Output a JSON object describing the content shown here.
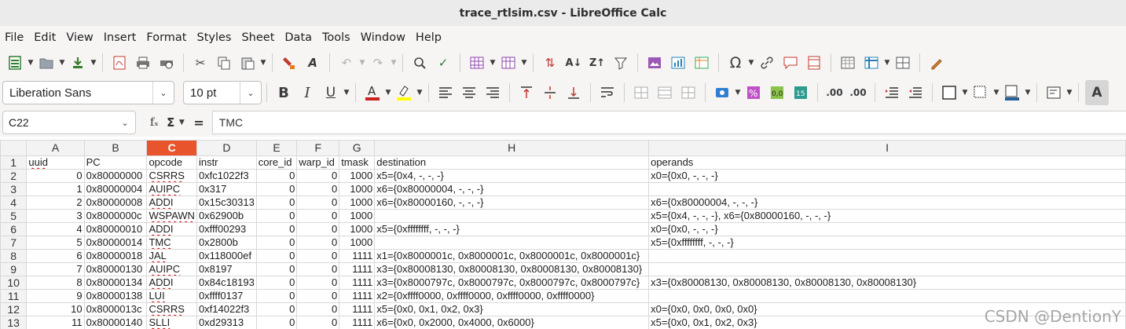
{
  "window": {
    "title": "trace_rtlsim.csv - LibreOffice Calc"
  },
  "menu": [
    "File",
    "Edit",
    "View",
    "Insert",
    "Format",
    "Styles",
    "Sheet",
    "Data",
    "Tools",
    "Window",
    "Help"
  ],
  "format_bar": {
    "font_name": "Liberation Sans",
    "font_size": "10 pt"
  },
  "formula_bar": {
    "cell_ref": "C22",
    "fx_label": "fₓ",
    "sigma_label": "Σ",
    "eq_label": "=",
    "content": "TMC"
  },
  "columns": [
    "A",
    "B",
    "C",
    "D",
    "E",
    "F",
    "G",
    "H",
    "I"
  ],
  "selected_column": "C",
  "rows": [
    {
      "n": "1",
      "cells": [
        "uuid",
        "PC",
        "opcode",
        "instr",
        "core_id",
        "warp_id",
        "tmask",
        "destination",
        "operands"
      ]
    },
    {
      "n": "2",
      "cells": [
        "0",
        "0x80000000",
        "CSRRS",
        "0xfc1022f3",
        "0",
        "0",
        "1000",
        "x5={0x4, -, -, -}",
        "x0={0x0, -, -, -}"
      ]
    },
    {
      "n": "3",
      "cells": [
        "1",
        "0x80000004",
        "AUIPC",
        "0x317",
        "0",
        "0",
        "1000",
        "x6={0x80000004, -, -, -}",
        ""
      ]
    },
    {
      "n": "4",
      "cells": [
        "2",
        "0x80000008",
        "ADDI",
        "0x15c30313",
        "0",
        "0",
        "1000",
        "x6={0x80000160, -, -, -}",
        "x6={0x80000004, -, -, -}"
      ]
    },
    {
      "n": "5",
      "cells": [
        "3",
        "0x8000000c",
        "WSPAWN",
        "0x62900b",
        "0",
        "0",
        "1000",
        "",
        "x5={0x4, -, -, -}, x6={0x80000160, -, -, -}"
      ]
    },
    {
      "n": "6",
      "cells": [
        "4",
        "0x80000010",
        "ADDI",
        "0xfff00293",
        "0",
        "0",
        "1000",
        "x5={0xffffffff, -, -, -}",
        "x0={0x0, -, -, -}"
      ]
    },
    {
      "n": "7",
      "cells": [
        "5",
        "0x80000014",
        "TMC",
        "0x2800b",
        "0",
        "0",
        "1000",
        "",
        "x5={0xffffffff, -, -, -}"
      ]
    },
    {
      "n": "8",
      "cells": [
        "6",
        "0x80000018",
        "JAL",
        "0x118000ef",
        "0",
        "0",
        "1111",
        "x1={0x8000001c, 0x8000001c, 0x8000001c, 0x8000001c}",
        ""
      ]
    },
    {
      "n": "9",
      "cells": [
        "7",
        "0x80000130",
        "AUIPC",
        "0x8197",
        "0",
        "0",
        "1111",
        "x3={0x80008130, 0x80008130, 0x80008130, 0x80008130}",
        ""
      ]
    },
    {
      "n": "10",
      "cells": [
        "8",
        "0x80000134",
        "ADDI",
        "0x84c18193",
        "0",
        "0",
        "1111",
        "x3={0x8000797c, 0x8000797c, 0x8000797c, 0x8000797c}",
        "x3={0x80008130, 0x80008130, 0x80008130, 0x80008130}"
      ]
    },
    {
      "n": "11",
      "cells": [
        "9",
        "0x80000138",
        "LUI",
        "0xffff0137",
        "0",
        "0",
        "1111",
        "x2={0xffff0000, 0xffff0000, 0xffff0000, 0xffff0000}",
        ""
      ]
    },
    {
      "n": "12",
      "cells": [
        "10",
        "0x8000013c",
        "CSRRS",
        "0xf14022f3",
        "0",
        "0",
        "1111",
        "x5={0x0, 0x1, 0x2, 0x3}",
        "x0={0x0, 0x0, 0x0, 0x0}"
      ]
    },
    {
      "n": "13",
      "cells": [
        "11",
        "0x80000140",
        "SLLI",
        "0xd29313",
        "0",
        "0",
        "1111",
        "x6={0x0, 0x2000, 0x4000, 0x6000}",
        "x5={0x0, 0x1, 0x2, 0x3}"
      ]
    }
  ],
  "watermark": "CSDN @DentionY"
}
